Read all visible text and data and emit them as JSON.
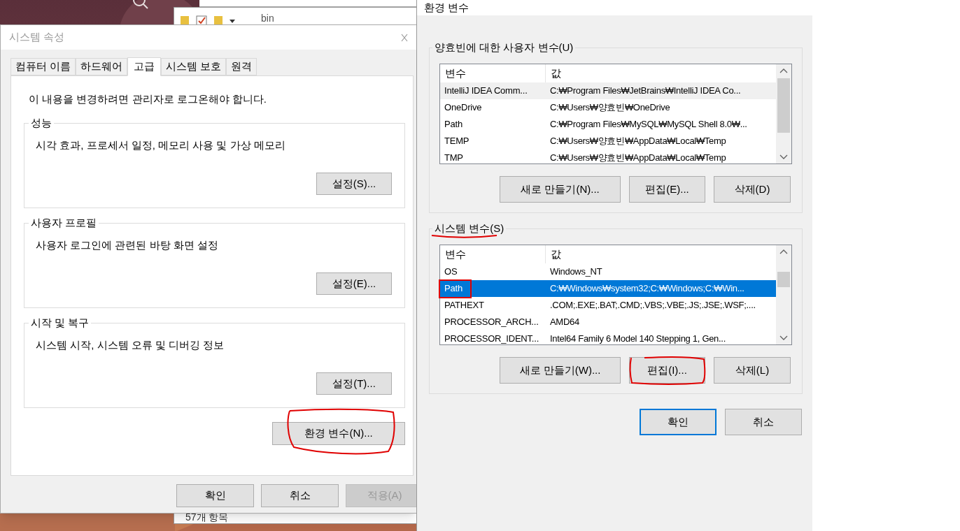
{
  "explorer_window": {
    "title": "bin",
    "status": "57개 항목"
  },
  "system_properties": {
    "title": "시스템 속성",
    "tabs": [
      {
        "label": "컴퓨터 이름",
        "selected": false
      },
      {
        "label": "하드웨어",
        "selected": false
      },
      {
        "label": "고급",
        "selected": true
      },
      {
        "label": "시스템 보호",
        "selected": false
      },
      {
        "label": "원격",
        "selected": false
      }
    ],
    "notice": "이 내용을 변경하려면 관리자로 로그온해야 합니다.",
    "groups": [
      {
        "title": "성능",
        "description": "시각 효과, 프로세서 일정, 메모리 사용 및 가상 메모리",
        "button": "설정(S)..."
      },
      {
        "title": "사용자 프로필",
        "description": "사용자 로그인에 관련된 바탕 화면 설정",
        "button": "설정(E)..."
      },
      {
        "title": "시작 및 복구",
        "description": "시스템 시작, 시스템 오류 및 디버깅 정보",
        "button": "설정(T)..."
      }
    ],
    "env_button": "환경 변수(N)...",
    "buttons": [
      {
        "label": "확인",
        "disabled": false
      },
      {
        "label": "취소",
        "disabled": false
      },
      {
        "label": "적용(A)",
        "disabled": true
      }
    ]
  },
  "env_dialog": {
    "title": "환경 변수",
    "sections": [
      {
        "title": "양효빈에 대한 사용자 변수(U)",
        "focused": false,
        "columns": [
          "변수",
          "값"
        ],
        "rows": [
          {
            "name": "IntelliJ IDEA Comm...",
            "value": "C:₩Program Files₩JetBrains₩IntelliJ IDEA Co...",
            "selected": true
          },
          {
            "name": "OneDrive",
            "value": "C:₩Users₩양효빈₩OneDrive",
            "selected": false
          },
          {
            "name": "Path",
            "value": "C:₩Program Files₩MySQL₩MySQL Shell 8.0₩...",
            "selected": false
          },
          {
            "name": "TEMP",
            "value": "C:₩Users₩양효빈₩AppData₩Local₩Temp",
            "selected": false
          },
          {
            "name": "TMP",
            "value": "C:₩Users₩양효빈₩AppData₩Local₩Temp",
            "selected": false
          }
        ],
        "buttons": [
          "새로 만들기(N)...",
          "편집(E)...",
          "삭제(D)"
        ]
      },
      {
        "title": "시스템 변수(S)",
        "focused": true,
        "columns": [
          "변수",
          "값"
        ],
        "rows": [
          {
            "name": "OS",
            "value": "Windows_NT",
            "selected": false
          },
          {
            "name": "Path",
            "value": "C:₩Windows₩system32;C:₩Windows;C:₩Win...",
            "selected": true
          },
          {
            "name": "PATHEXT",
            "value": ".COM;.EXE;.BAT;.CMD;.VBS;.VBE;.JS;.JSE;.WSF;....",
            "selected": false
          },
          {
            "name": "PROCESSOR_ARCH...",
            "value": "AMD64",
            "selected": false
          },
          {
            "name": "PROCESSOR_IDENT...",
            "value": "Intel64 Family 6 Model 140 Stepping 1, Gen...",
            "selected": false
          }
        ],
        "buttons": [
          "새로 만들기(W)...",
          "편집(I)...",
          "삭제(L)"
        ]
      }
    ],
    "buttons": [
      {
        "label": "확인",
        "default": true
      },
      {
        "label": "취소",
        "default": false
      }
    ]
  }
}
